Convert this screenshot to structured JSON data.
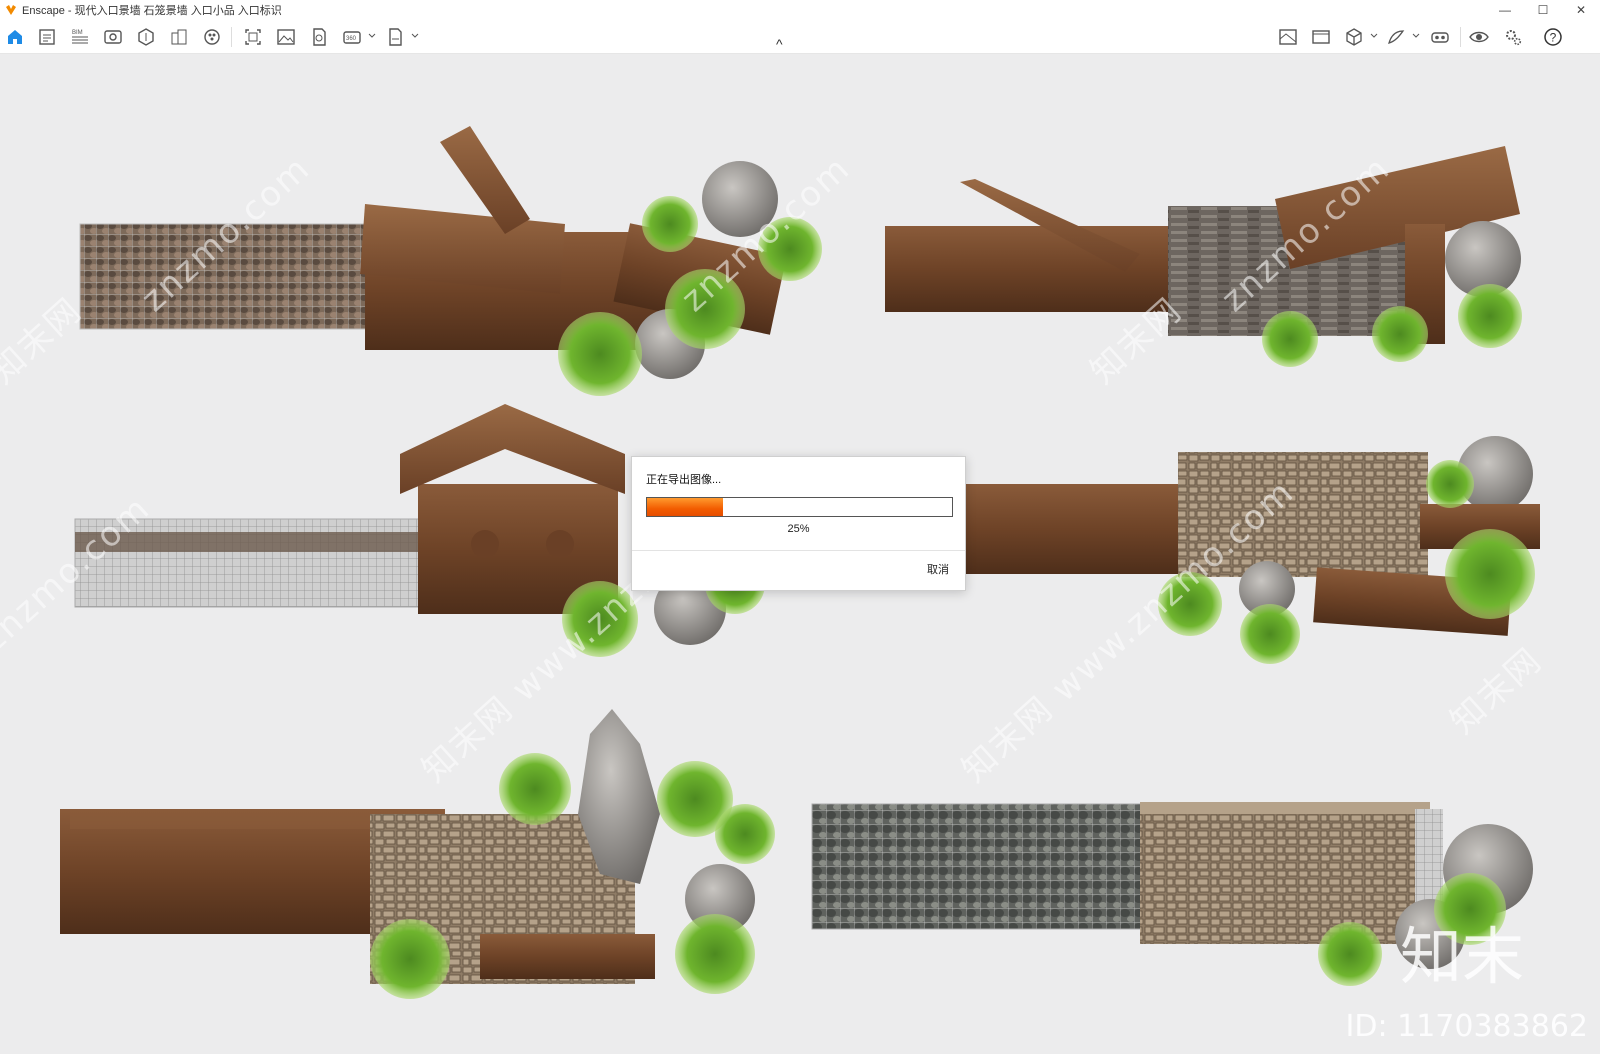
{
  "window": {
    "title": "Enscape - 现代入口景墙 石笼景墙 入口小品 入口标识",
    "controls": {
      "minimize": "—",
      "maximize": "☐",
      "close": "✕"
    }
  },
  "toolbar": {
    "left_icons": [
      "home-icon",
      "visual-settings-icon",
      "bim-icon",
      "view-icon",
      "assets-icon",
      "buildings-icon",
      "materials-icon",
      "screenshot-icon",
      "image-export-icon",
      "video-icon",
      "panorama-360-icon",
      "export-file-icon"
    ],
    "right_icons": [
      "map-icon",
      "image-icon",
      "cube-icon",
      "sketch-icon",
      "vr-headset-icon",
      "eye-icon",
      "settings-icon",
      "help-icon"
    ],
    "collapse": "^",
    "bim_label": "BIM",
    "pano_label": "360"
  },
  "watermarks": [
    "znzmo.com",
    "知末网 www.znzmo.com",
    "知末网"
  ],
  "brand_mark": "知末",
  "image_id": "ID: 1170383862",
  "dialog": {
    "title": "正在导出图像...",
    "progress": 0.25,
    "progress_text": "25%",
    "cancel_label": "取消"
  },
  "colors": {
    "accent": "#f26a00",
    "toolbar_blue": "#1e8be6",
    "background": "#ececed"
  }
}
